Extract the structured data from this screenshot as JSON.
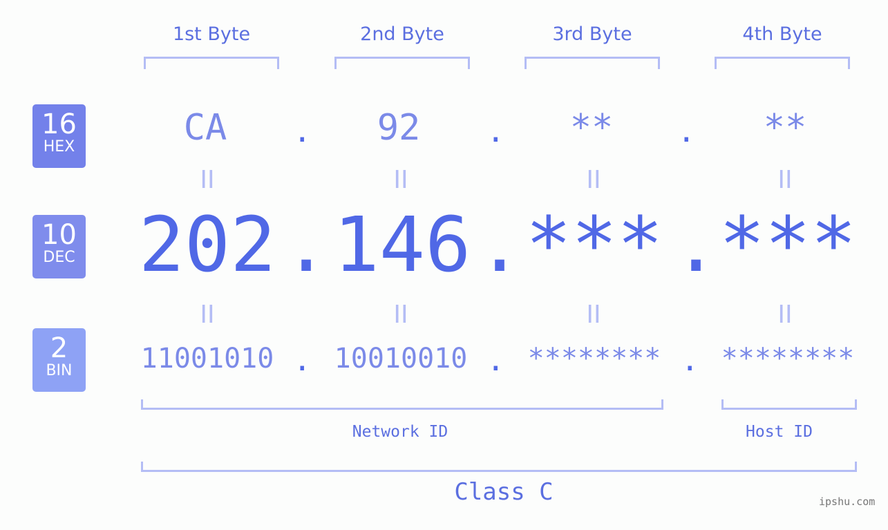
{
  "bytes": [
    "1st Byte",
    "2nd Byte",
    "3rd Byte",
    "4th Byte"
  ],
  "rows": {
    "hex": {
      "base": "16",
      "label": "HEX",
      "values": [
        "CA",
        "92",
        "**",
        "**"
      ],
      "color": "#7381ea"
    },
    "dec": {
      "base": "10",
      "label": "DEC",
      "values": [
        "202",
        "146",
        "***",
        "***"
      ],
      "color": "#7f8cec"
    },
    "bin": {
      "base": "2",
      "label": "BIN",
      "values": [
        "11001010",
        "10010010",
        "********",
        "********"
      ],
      "color": "#8ea2f5"
    }
  },
  "separator": ".",
  "equals": "II",
  "network_label": "Network ID",
  "host_label": "Host ID",
  "class_label": "Class C",
  "watermark": "ipshu.com"
}
